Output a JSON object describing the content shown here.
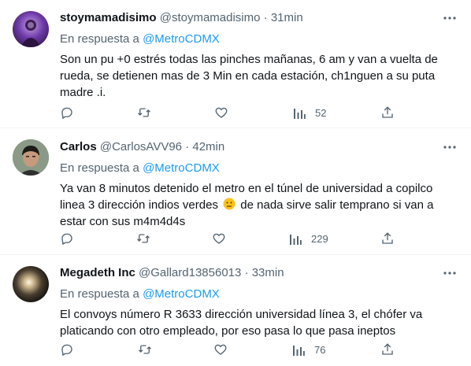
{
  "tweets": [
    {
      "name": "stoymamadisimo",
      "handle": "@stoymamadisimo",
      "dot": "·",
      "time": "31min",
      "reply_prefix": "En respuesta a",
      "reply_mention": "@MetroCDMX",
      "text": "Son un pu +0 estrés todas las pinches mañanas, 6 am y van a vuelta de rueda, se detienen mas de 3 Min en cada estación, ch1nguen a su puta madre .i.",
      "views": "52"
    },
    {
      "name": "Carlos",
      "handle": "@CarlosAVV96",
      "dot": "·",
      "time": "42min",
      "reply_prefix": "En respuesta a",
      "reply_mention": "@MetroCDMX",
      "text_before_emoji": "Ya van 8 minutos detenido el metro en el túnel de universidad a copilco linea 3 dirección indios verdes",
      "text_after_emoji": " de nada sirve salir temprano si van a estar con sus m4m4d4s",
      "views": "229"
    },
    {
      "name": "Megadeth Inc",
      "handle": "@Gallard13856013",
      "dot": "·",
      "time": "33min",
      "reply_prefix": "En respuesta a",
      "reply_mention": "@MetroCDMX",
      "text": "El convoys número R 3633 dirección universidad línea 3, el chófer va platicando con otro empleado, por eso pasa lo que pasa ineptos",
      "views": "76"
    }
  ],
  "icons": {
    "more": "more-horizontal-icon",
    "reply": "reply-icon",
    "retweet": "retweet-icon",
    "like": "heart-icon",
    "views": "views-chart-icon",
    "share": "share-icon",
    "emoji": "neutral-face-emoji"
  },
  "colors": {
    "text": "#0f1419",
    "secondary": "#536471",
    "link": "#1d9bf0",
    "divider": "#eff3f4"
  }
}
